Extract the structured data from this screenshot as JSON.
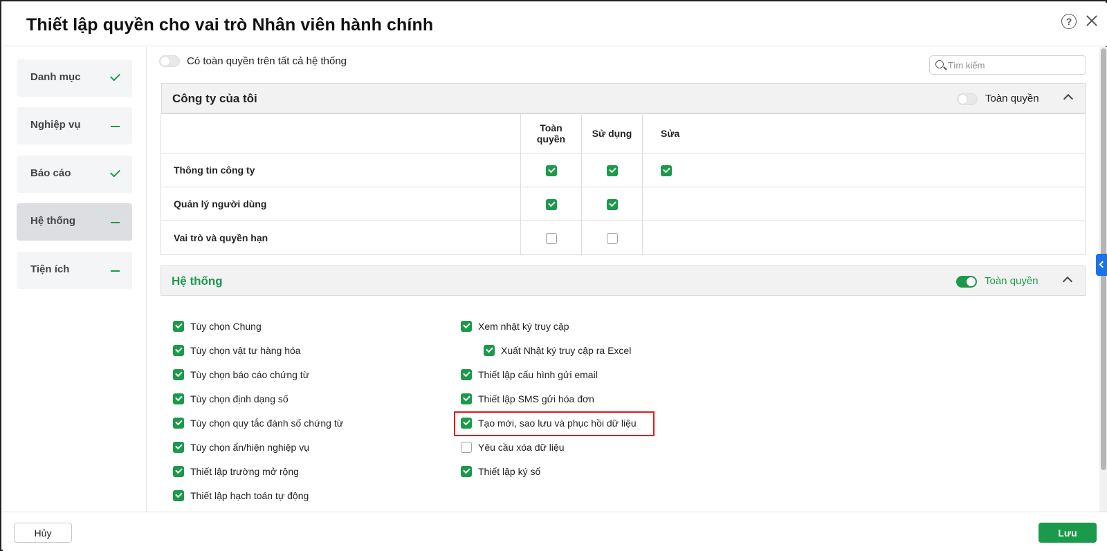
{
  "dialog": {
    "title": "Thiết lập quyền cho vai trò Nhân viên hành chính",
    "help_icon": "question-circle-icon",
    "close_icon": "close-icon"
  },
  "sidebar": {
    "items": [
      {
        "label": "Danh mục",
        "status": "check"
      },
      {
        "label": "Nghiệp vụ",
        "status": "partial"
      },
      {
        "label": "Báo cáo",
        "status": "check"
      },
      {
        "label": "Hệ thống",
        "status": "partial",
        "active": true
      },
      {
        "label": "Tiện ích",
        "status": "partial"
      }
    ]
  },
  "main": {
    "all_system_toggle": {
      "label": "Có toàn quyền trên tất cả hệ thống",
      "on": false
    },
    "search": {
      "placeholder": "Tìm kiếm",
      "value": ""
    }
  },
  "company_section": {
    "title": "Công ty của tôi",
    "full_toggle": {
      "label": "Toàn quyền",
      "on": false
    },
    "columns": [
      "Toàn quyền",
      "Sử dụng",
      "Sửa"
    ],
    "rows": [
      {
        "name": "Thông tin công ty",
        "cells": [
          true,
          true,
          true
        ]
      },
      {
        "name": "Quản lý người dùng",
        "cells": [
          true,
          true,
          null
        ]
      },
      {
        "name": "Vai trò và quyền hạn",
        "cells": [
          false,
          false,
          null
        ]
      }
    ]
  },
  "system_section": {
    "title": "Hệ thống",
    "full_toggle": {
      "label": "Toàn quyền",
      "on": true
    },
    "left_items": [
      {
        "label": "Tùy chọn Chung",
        "checked": true
      },
      {
        "label": "Tùy chọn vật tư hàng hóa",
        "checked": true
      },
      {
        "label": "Tùy chọn báo cáo chứng từ",
        "checked": true
      },
      {
        "label": "Tùy chọn định dạng số",
        "checked": true
      },
      {
        "label": "Tùy chọn quy tắc đánh số chứng từ",
        "checked": true
      },
      {
        "label": "Tùy chọn ẩn/hiện nghiệp vụ",
        "checked": true
      },
      {
        "label": "Thiết lập trường mở rộng",
        "checked": true
      },
      {
        "label": "Thiết lập hạch toán tự động",
        "checked": true
      }
    ],
    "right_items": [
      {
        "label": "Xem nhật ký truy cập",
        "checked": true
      },
      {
        "label": "Xuất Nhật ký truy cập ra Excel",
        "checked": true,
        "indent": true
      },
      {
        "label": "Thiết lập cấu hình gửi email",
        "checked": true
      },
      {
        "label": "Thiết lập SMS gửi hóa đơn",
        "checked": true
      },
      {
        "label": "Tạo mới, sao lưu và phục hồi dữ liệu",
        "checked": true,
        "highlighted": true
      },
      {
        "label": "Yêu cầu xóa dữ liệu",
        "checked": false
      },
      {
        "label": "Thiết lập ký số",
        "checked": true
      }
    ]
  },
  "footer": {
    "cancel_label": "Hủy",
    "save_label": "Lưu"
  },
  "colors": {
    "accent_green": "#1a9a4a",
    "highlight_red": "#e21b1b",
    "side_tab_blue": "#1a73e8"
  }
}
